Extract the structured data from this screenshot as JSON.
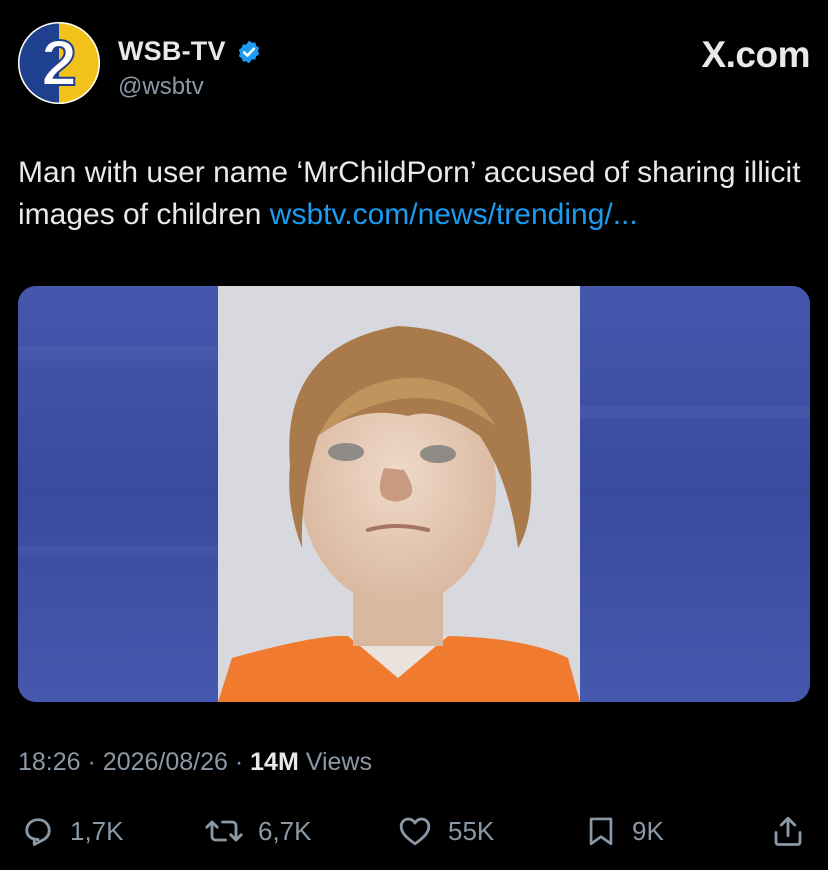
{
  "account": {
    "display_name": "WSB-TV",
    "handle": "@wsbtv",
    "avatar_text": "2"
  },
  "brand": {
    "label": "X.com"
  },
  "tweet": {
    "text": "Man with user name ‘MrChildPorn’ accused of sharing illicit images of children ",
    "link": "wsbtv.com/news/trending/..."
  },
  "meta": {
    "time": "18:26",
    "date": "2026/08/26",
    "views_count": "14M",
    "views_label": "Views"
  },
  "actions": {
    "replies": "1,7K",
    "reposts": "6,7K",
    "likes": "55K",
    "bookmarks": "9K"
  },
  "colors": {
    "background": "#000000",
    "link": "#1d9bf0",
    "secondary_text": "#8b98a5",
    "verified": "#1d9bf0",
    "media_backdrop": "#3f4fa3",
    "jumpsuit": "#f07a2e"
  },
  "icons": [
    "verified-badge-icon",
    "reply-icon",
    "repost-icon",
    "like-icon",
    "bookmark-icon",
    "share-icon"
  ]
}
